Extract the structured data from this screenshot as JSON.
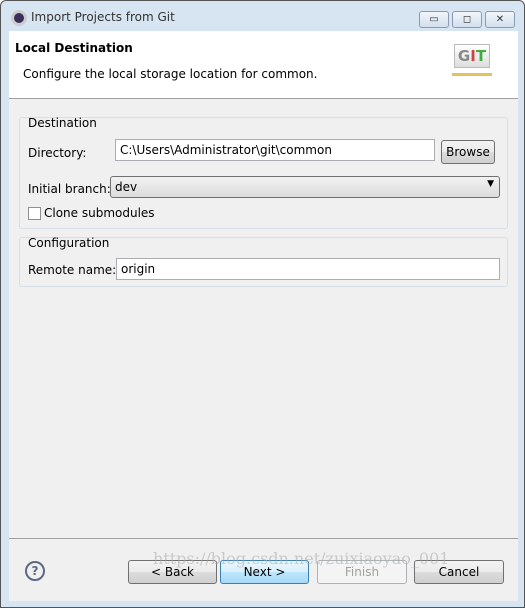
{
  "window": {
    "title": "Import Projects from Git",
    "minimize": "▭",
    "maximize": "◻",
    "close": "✕"
  },
  "banner": {
    "title": "Local Destination",
    "subtitle": "Configure the local storage location for common.",
    "logo_text": "GIT"
  },
  "destination": {
    "group_label": "Destination",
    "directory_label": "Directory:",
    "directory_value": "C:\\Users\\Administrator\\git\\common",
    "browse": "Browse",
    "branch_label": "Initial branch:",
    "branch_value": "dev",
    "clone_submodules": "Clone submodules",
    "clone_checked": false
  },
  "configuration": {
    "group_label": "Configuration",
    "remote_label": "Remote name:",
    "remote_value": "origin"
  },
  "footer": {
    "help": "?",
    "back": "< Back",
    "next": "Next >",
    "finish": "Finish",
    "cancel": "Cancel"
  },
  "watermark": "https://blog.csdn.net/zuixiaoyao_001"
}
